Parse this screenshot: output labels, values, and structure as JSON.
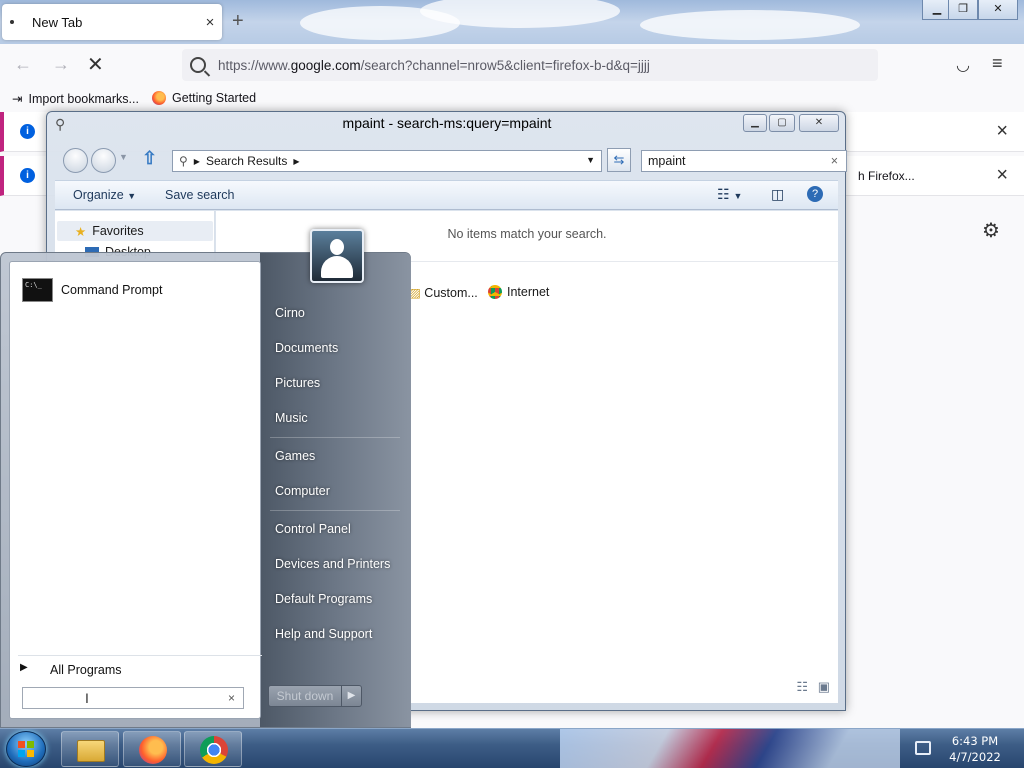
{
  "firefox": {
    "tab_title": "New Tab",
    "tab_close": "×",
    "new_tab": "+",
    "url_prefix": "https://www.",
    "url_domain": "google.com",
    "url_rest": "/search?channel=nrow5&client=firefox-b-d&q=jjjj",
    "bookmarks": [
      "Import bookmarks...",
      "Getting Started"
    ],
    "notif_close": "×",
    "notif_partial_text": "h Firefox..."
  },
  "explorer": {
    "title": "mpaint - search-ms:query=mpaint",
    "address": "Search Results",
    "search_value": "mpaint",
    "toolbar": {
      "organize": "Organize",
      "save_search": "Save search"
    },
    "nav": {
      "favorites": "Favorites",
      "desktop": "Desktop"
    },
    "empty_message": "No items match your search.",
    "search_again": [
      "Custom...",
      "Internet"
    ]
  },
  "start_menu": {
    "pinned": [
      {
        "label": "Command Prompt"
      }
    ],
    "all_programs": "All Programs",
    "right_links": [
      "Cirno",
      "Documents",
      "Pictures",
      "Music",
      "Games",
      "Computer",
      "Control Panel",
      "Devices and Printers",
      "Default Programs",
      "Help and Support"
    ],
    "shutdown_label": "Shut down",
    "search_value": ""
  },
  "taskbar": {
    "apps": [
      "windows-explorer",
      "firefox",
      "chrome"
    ],
    "time": "6:43 PM",
    "date": "4/7/2022"
  },
  "colors": {
    "firefox_accent": "#0060df",
    "notification_stripe": "#c0247f",
    "taskbar": "#3d5d86",
    "explorer_link": "#1e395b"
  }
}
